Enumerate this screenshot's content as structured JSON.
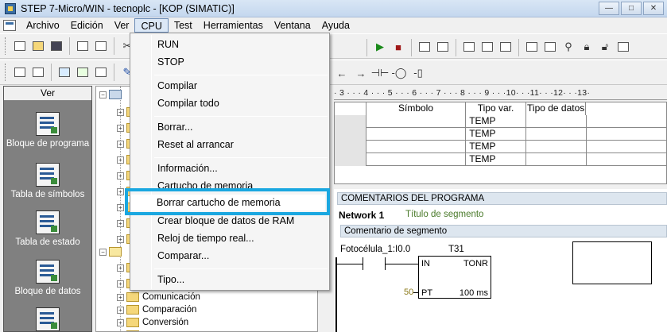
{
  "window": {
    "title": "STEP 7-Micro/WIN - tecnoplc - [KOP (SIMATIC)]",
    "controls": [
      "—",
      "□",
      "✕"
    ]
  },
  "menubar": {
    "items": [
      "Archivo",
      "Edición",
      "Ver",
      "CPU",
      "Test",
      "Herramientas",
      "Ventana",
      "Ayuda"
    ],
    "active": "CPU"
  },
  "toolbar2": {
    "nav_arrows": [
      "←",
      "→"
    ],
    "ladder_symbols": [
      "⊣⊢",
      "-◯",
      "-▯"
    ]
  },
  "leftbar": {
    "header": "Ver",
    "items": [
      "Bloque de programa",
      "Tabla de símbolos",
      "Tabla de estado",
      "Bloque de datos",
      ""
    ]
  },
  "tree": {
    "items": [
      "Comunicación",
      "Comparación",
      "Conversión"
    ]
  },
  "ruler": {
    "text": "· 3 · · · 4 · · · 5 · · · 6 · · · 7 · · · 8 · · · 9 · · ·10· · ·11· · ·12· · ·13·"
  },
  "var_table": {
    "headers": [
      "",
      "Símbolo",
      "Tipo var.",
      "Tipo de datos",
      ""
    ],
    "rows": [
      [
        "",
        "",
        "TEMP",
        "",
        ""
      ],
      [
        "",
        "",
        "TEMP",
        "",
        ""
      ],
      [
        "",
        "",
        "TEMP",
        "",
        ""
      ],
      [
        "",
        "",
        "TEMP",
        "",
        ""
      ]
    ]
  },
  "editor": {
    "program_comment": "COMENTARIOS DEL PROGRAMA",
    "network_label": "Network 1",
    "network_title": "Título de segmento",
    "segment_comment": "Comentario de segmento",
    "contact_label": "Fotocélula_1:I0.0",
    "timer_label": "T31",
    "timer_in": "IN",
    "timer_type": "TONR",
    "timer_pt": "PT",
    "timer_unit": "100 ms",
    "pt_value": "50"
  },
  "cpu_menu": {
    "items": [
      "RUN",
      "STOP",
      "Compilar",
      "Compilar todo",
      "Borrar...",
      "Reset al arrancar",
      "Información...",
      "Cartucho de memoria",
      "Borrar cartucho de memoria",
      "Crear bloque de datos de RAM",
      "Reloj de tiempo real...",
      "Comparar...",
      "Tipo..."
    ],
    "highlighted": "Borrar cartucho de memoria",
    "highlight_color": "#1aa7e0"
  }
}
